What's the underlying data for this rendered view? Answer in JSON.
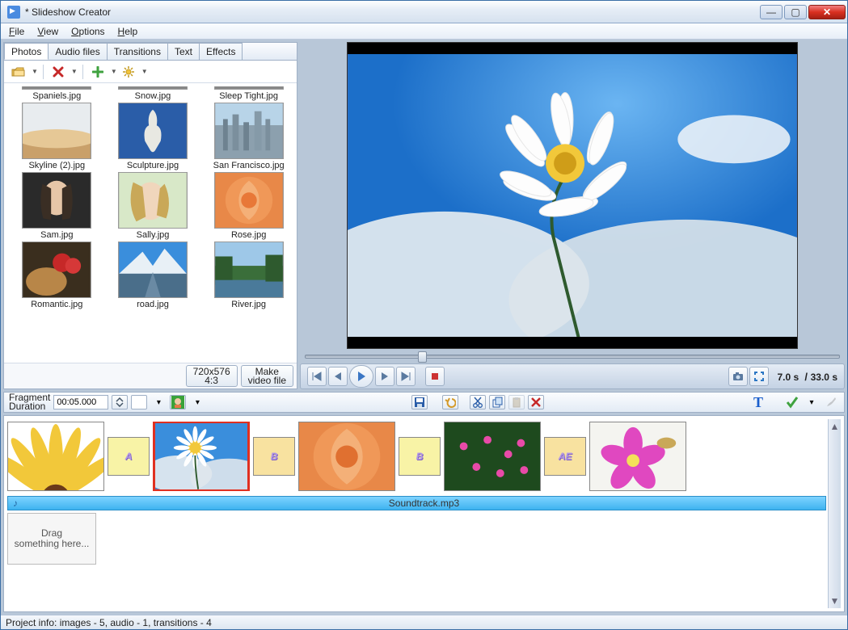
{
  "window": {
    "title": "*  Slideshow Creator"
  },
  "menu": {
    "file": "File",
    "view": "View",
    "options": "Options",
    "help": "Help"
  },
  "tabs": {
    "photos": "Photos",
    "audio": "Audio files",
    "transitions": "Transitions",
    "text": "Text",
    "effects": "Effects"
  },
  "thumbs_peek": [
    "Spaniels.jpg",
    "Snow.jpg",
    "Sleep Tight.jpg"
  ],
  "thumbs": [
    "Skyline (2).jpg",
    "Sculpture.jpg",
    "San Francisco.jpg",
    "Sam.jpg",
    "Sally.jpg",
    "Rose.jpg",
    "Romantic.jpg",
    "road.jpg",
    "River.jpg"
  ],
  "lp_buttons": {
    "res_line1": "720x576",
    "res_line2": "4:3",
    "make_line1": "Make",
    "make_line2": "video file"
  },
  "playback": {
    "time_current": "7.0 s",
    "time_total": "33.0 s",
    "seek_pct": 21
  },
  "tl": {
    "frag_label_1": "Fragment",
    "frag_label_2": "Duration",
    "duration": "00:05.000",
    "soundtrack": "Soundtrack.mp3",
    "dropzone_1": "Drag",
    "dropzone_2": "something here..."
  },
  "transitions": {
    "a": "A",
    "b": "B",
    "b2": "B",
    "ae": "AE"
  },
  "status": "Project info: images - 5, audio - 1, transitions - 4"
}
